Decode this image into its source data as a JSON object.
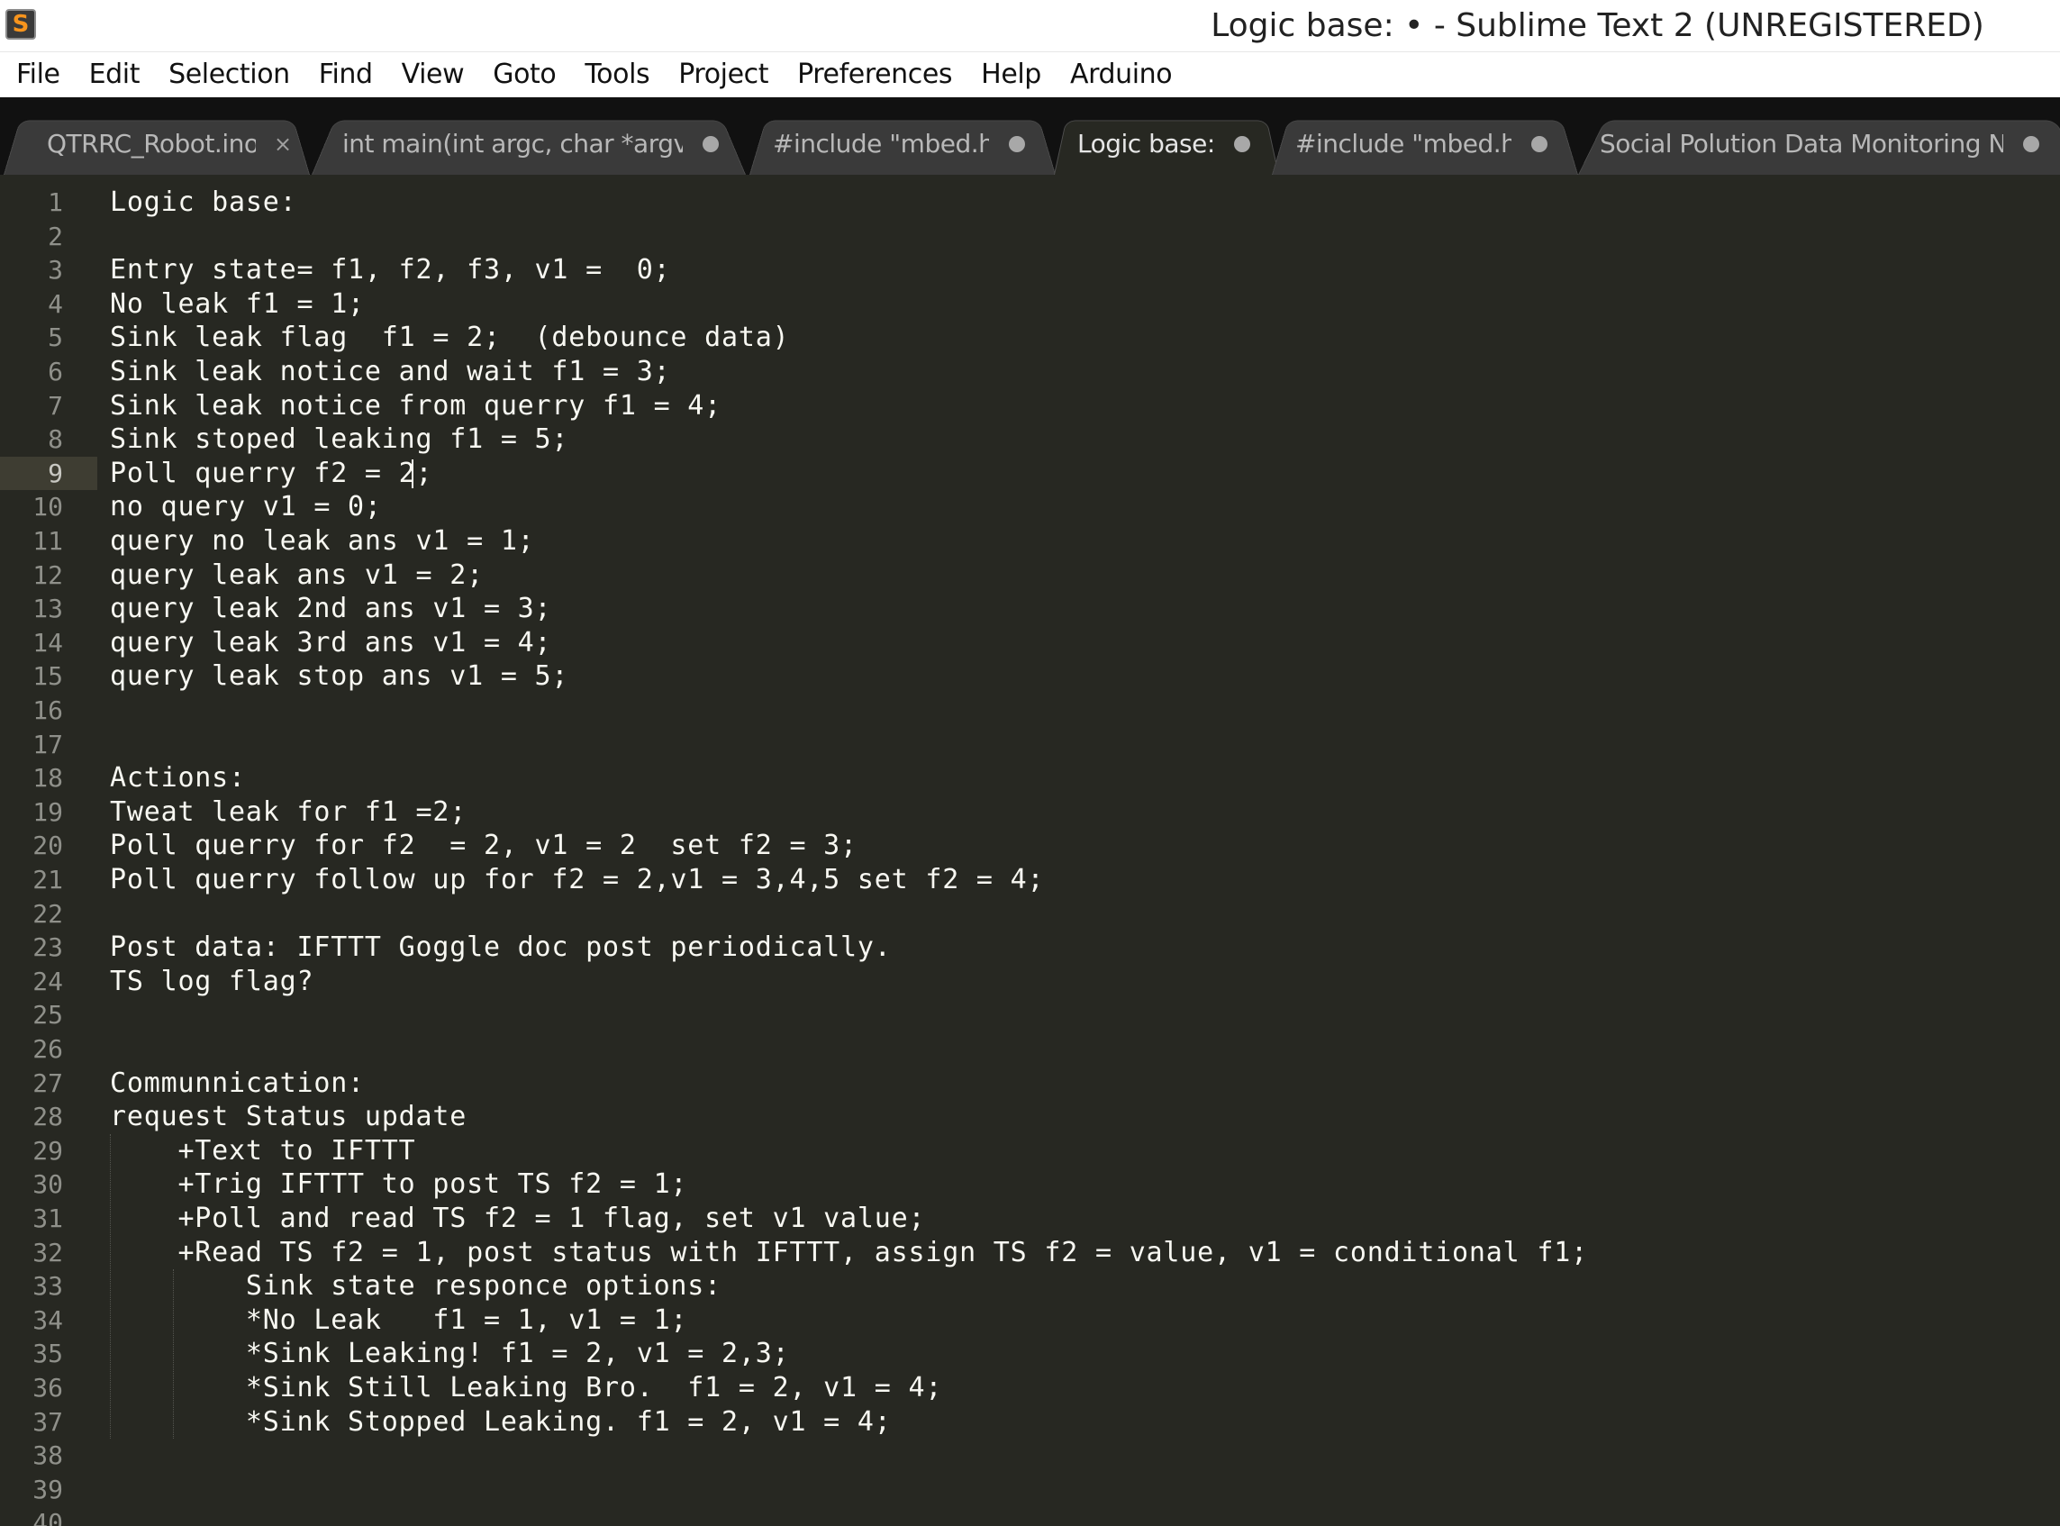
{
  "window": {
    "title": "Logic base: • - Sublime Text 2 (UNREGISTERED)",
    "app_icon": "S"
  },
  "menu": [
    "File",
    "Edit",
    "Selection",
    "Find",
    "View",
    "Goto",
    "Tools",
    "Project",
    "Preferences",
    "Help",
    "Arduino"
  ],
  "tabs": [
    {
      "label": "QTRRC_Robot.ino",
      "state": "close",
      "active": false
    },
    {
      "label": "int main(int argc, char *argv[])",
      "state": "dirty",
      "active": false
    },
    {
      "label": "#include \"mbed.h\"",
      "state": "dirty",
      "active": false
    },
    {
      "label": "Logic base:",
      "state": "dirty",
      "active": true
    },
    {
      "label": "#include \"mbed.h\"",
      "state": "dirty",
      "active": false
    },
    {
      "label": "Social Polution Data Monitoring N",
      "state": "dirty",
      "active": false
    }
  ],
  "editor": {
    "current_line": 9,
    "lines": [
      "Logic base:",
      "",
      "Entry state= f1, f2, f3, v1 =  0;",
      "No leak f1 = 1;",
      "Sink leak flag  f1 = 2;  (debounce data)",
      "Sink leak notice and wait f1 = 3;",
      "Sink leak notice from querry f1 = 4;",
      "Sink stoped leaking f1 = 5;",
      "Poll querry f2 = 2;",
      "no query v1 = 0;",
      "query no leak ans v1 = 1;",
      "query leak ans v1 = 2;",
      "query leak 2nd ans v1 = 3;",
      "query leak 3rd ans v1 = 4;",
      "query leak stop ans v1 = 5;",
      "",
      "",
      "Actions:",
      "Tweat leak for f1 =2;",
      "Poll querry for f2  = 2, v1 = 2  set f2 = 3;",
      "Poll querry follow up for f2 = 2,v1 = 3,4,5 set f2 = 4;",
      "",
      "Post data: IFTTT Goggle doc post periodically.",
      "TS log flag?",
      "",
      "",
      "Communnication:",
      "request Status update",
      "    +Text to IFTTT",
      "    +Trig IFTTT to post TS f2 = 1;",
      "    +Poll and read TS f2 = 1 flag, set v1 value;",
      "    +Read TS f2 = 1, post status with IFTTT, assign TS f2 = value, v1 = conditional f1;",
      "        Sink state responce options:",
      "        *No Leak   f1 = 1, v1 = 1;",
      "        *Sink Leaking! f1 = 2, v1 = 2,3;",
      "        *Sink Still Leaking Bro.  f1 = 2, v1 = 4;",
      "        *Sink Stopped Leaking. f1 = 2, v1 = 4;",
      "",
      "",
      ""
    ]
  }
}
